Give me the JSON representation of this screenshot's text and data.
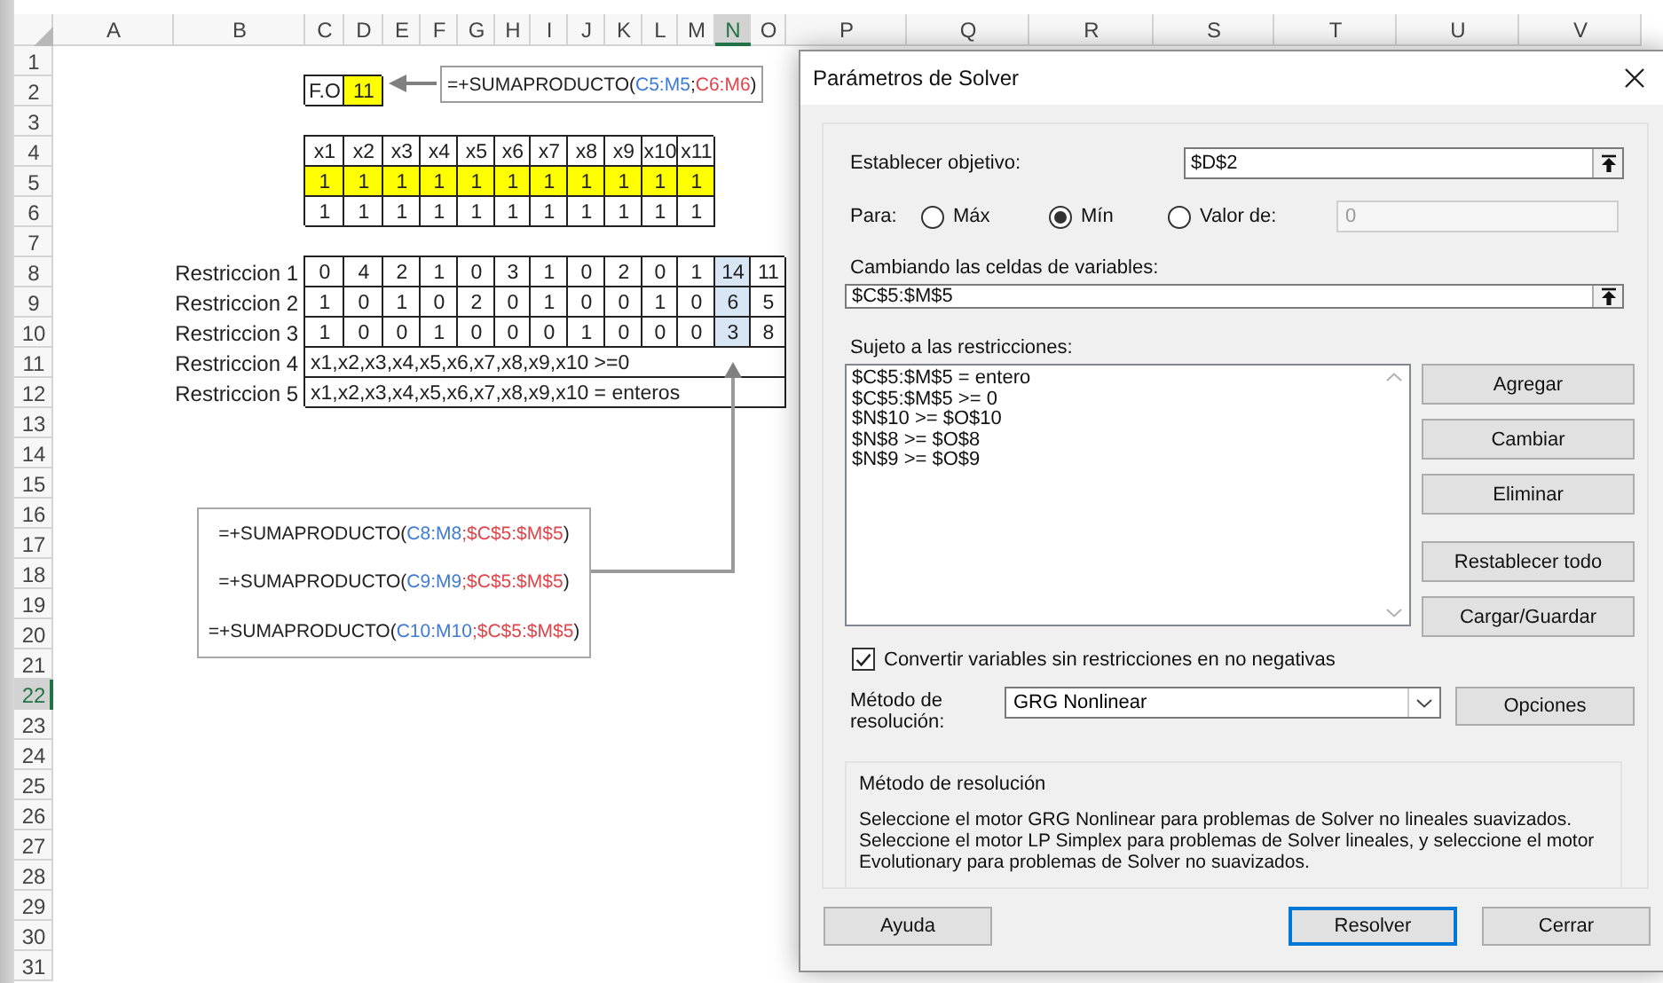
{
  "sheet": {
    "columns": [
      {
        "label": "A",
        "selected": false
      },
      {
        "label": "B",
        "selected": false
      },
      {
        "label": "C",
        "selected": false
      },
      {
        "label": "D",
        "selected": false
      },
      {
        "label": "E",
        "selected": false
      },
      {
        "label": "F",
        "selected": false
      },
      {
        "label": "G",
        "selected": false
      },
      {
        "label": "H",
        "selected": false
      },
      {
        "label": "I",
        "selected": false
      },
      {
        "label": "J",
        "selected": false
      },
      {
        "label": "K",
        "selected": false
      },
      {
        "label": "L",
        "selected": false
      },
      {
        "label": "M",
        "selected": false
      },
      {
        "label": "N",
        "selected": true
      },
      {
        "label": "O",
        "selected": false
      },
      {
        "label": "P",
        "selected": false
      },
      {
        "label": "Q",
        "selected": false
      },
      {
        "label": "R",
        "selected": false
      },
      {
        "label": "S",
        "selected": false
      },
      {
        "label": "T",
        "selected": false
      },
      {
        "label": "U",
        "selected": false
      },
      {
        "label": "V",
        "selected": false
      }
    ],
    "rows": [
      {
        "label": "1",
        "selected": false
      },
      {
        "label": "2",
        "selected": false
      },
      {
        "label": "3",
        "selected": false
      },
      {
        "label": "4",
        "selected": false
      },
      {
        "label": "5",
        "selected": false
      },
      {
        "label": "6",
        "selected": false
      },
      {
        "label": "7",
        "selected": false
      },
      {
        "label": "8",
        "selected": false
      },
      {
        "label": "9",
        "selected": false
      },
      {
        "label": "10",
        "selected": false
      },
      {
        "label": "11",
        "selected": false
      },
      {
        "label": "12",
        "selected": false
      },
      {
        "label": "13",
        "selected": false
      },
      {
        "label": "14",
        "selected": false
      },
      {
        "label": "15",
        "selected": false
      },
      {
        "label": "16",
        "selected": false
      },
      {
        "label": "17",
        "selected": false
      },
      {
        "label": "18",
        "selected": false
      },
      {
        "label": "19",
        "selected": false
      },
      {
        "label": "20",
        "selected": false
      },
      {
        "label": "21",
        "selected": false
      },
      {
        "label": "22",
        "selected": true
      },
      {
        "label": "23",
        "selected": false
      },
      {
        "label": "24",
        "selected": false
      },
      {
        "label": "25",
        "selected": false
      },
      {
        "label": "26",
        "selected": false
      },
      {
        "label": "27",
        "selected": false
      },
      {
        "label": "28",
        "selected": false
      },
      {
        "label": "29",
        "selected": false
      },
      {
        "label": "30",
        "selected": false
      },
      {
        "label": "31",
        "selected": false
      }
    ],
    "objective": {
      "label": "F.O",
      "value": "11",
      "highlighted": true
    },
    "objective_formula": [
      {
        "text": "=+SUMAPRODUCTO(",
        "color": "#222222"
      },
      {
        "text": "C5:M5",
        "color": "#3f7ad6"
      },
      {
        "text": ";",
        "color": "#222222"
      },
      {
        "text": "C6:M6",
        "color": "#e0454b"
      },
      {
        "text": ")",
        "color": "#222222"
      }
    ],
    "variables": {
      "headers": [
        "x1",
        "x2",
        "x3",
        "x4",
        "x5",
        "x6",
        "x7",
        "x8",
        "x9",
        "x10",
        "x11"
      ],
      "rows": [
        {
          "highlighted": true,
          "cells": [
            "1",
            "1",
            "1",
            "1",
            "1",
            "1",
            "1",
            "1",
            "1",
            "1",
            "1"
          ]
        },
        {
          "highlighted": false,
          "cells": [
            "1",
            "1",
            "1",
            "1",
            "1",
            "1",
            "1",
            "1",
            "1",
            "1",
            "1"
          ]
        }
      ]
    },
    "constraints": [
      {
        "label": "Restriccion 1",
        "kind": "values",
        "cells": [
          {
            "value": "0",
            "selected": false
          },
          {
            "value": "4",
            "selected": false
          },
          {
            "value": "2",
            "selected": false
          },
          {
            "value": "1",
            "selected": false
          },
          {
            "value": "0",
            "selected": false
          },
          {
            "value": "3",
            "selected": false
          },
          {
            "value": "1",
            "selected": false
          },
          {
            "value": "0",
            "selected": false
          },
          {
            "value": "2",
            "selected": false
          },
          {
            "value": "0",
            "selected": false
          },
          {
            "value": "1",
            "selected": false
          },
          {
            "value": "14",
            "selected": true
          },
          {
            "value": "11",
            "selected": false
          }
        ]
      },
      {
        "label": "Restriccion 2",
        "kind": "values",
        "cells": [
          {
            "value": "1",
            "selected": false
          },
          {
            "value": "0",
            "selected": false
          },
          {
            "value": "1",
            "selected": false
          },
          {
            "value": "0",
            "selected": false
          },
          {
            "value": "2",
            "selected": false
          },
          {
            "value": "0",
            "selected": false
          },
          {
            "value": "1",
            "selected": false
          },
          {
            "value": "0",
            "selected": false
          },
          {
            "value": "0",
            "selected": false
          },
          {
            "value": "1",
            "selected": false
          },
          {
            "value": "0",
            "selected": false
          },
          {
            "value": "6",
            "selected": true
          },
          {
            "value": "5",
            "selected": false
          }
        ]
      },
      {
        "label": "Restriccion 3",
        "kind": "values",
        "cells": [
          {
            "value": "1",
            "selected": false
          },
          {
            "value": "0",
            "selected": false
          },
          {
            "value": "0",
            "selected": false
          },
          {
            "value": "1",
            "selected": false
          },
          {
            "value": "0",
            "selected": false
          },
          {
            "value": "0",
            "selected": false
          },
          {
            "value": "0",
            "selected": false
          },
          {
            "value": "1",
            "selected": false
          },
          {
            "value": "0",
            "selected": false
          },
          {
            "value": "0",
            "selected": false
          },
          {
            "value": "0",
            "selected": false
          },
          {
            "value": "3",
            "selected": true
          },
          {
            "value": "8",
            "selected": false
          }
        ]
      },
      {
        "label": "Restriccion 4",
        "kind": "text",
        "text": "x1,x2,x3,x4,x5,x6,x7,x8,x9,x10 >=0"
      },
      {
        "label": "Restriccion 5",
        "kind": "text",
        "text": "x1,x2,x3,x4,x5,x6,x7,x8,x9,x10 = enteros"
      }
    ],
    "formula_notes": [
      [
        {
          "text": "=+SUMAPRODUCTO(",
          "color": "#222222"
        },
        {
          "text": "C8:M8",
          "color": "#3f7ad6"
        },
        {
          "text": ";$C$5:$M$5",
          "color": "#e0454b"
        },
        {
          "text": ")",
          "color": "#222222"
        }
      ],
      [
        {
          "text": "=+SUMAPRODUCTO(",
          "color": "#222222"
        },
        {
          "text": "C9:M9",
          "color": "#3f7ad6"
        },
        {
          "text": ";$C$5:$M$5",
          "color": "#e0454b"
        },
        {
          "text": ")",
          "color": "#222222"
        }
      ],
      [
        {
          "text": "=+SUMAPRODUCTO(",
          "color": "#222222"
        },
        {
          "text": "C10:M10",
          "color": "#3f7ad6"
        },
        {
          "text": ";$C$5:$M$5",
          "color": "#e0454b"
        },
        {
          "text": ")",
          "color": "#222222"
        }
      ]
    ]
  },
  "dialog": {
    "title": "Parámetros de Solver",
    "objective": {
      "label": "Establecer objetivo:",
      "value": "$D$2"
    },
    "goal": {
      "label": "Para:",
      "options": [
        {
          "label": "Máx",
          "selected": false
        },
        {
          "label": "Mín",
          "selected": true
        },
        {
          "label": "Valor de:",
          "selected": false
        }
      ],
      "target": {
        "value": "0",
        "disabled": true
      }
    },
    "variables": {
      "label": "Cambiando las celdas de variables:",
      "value": "$C$5:$M$5"
    },
    "constraints": {
      "label": "Sujeto a las restricciones:",
      "items": [
        "$C$5:$M$5 = entero",
        "$C$5:$M$5 >= 0",
        "$N$10 >= $O$10",
        "$N$8 >= $O$8",
        "$N$9 >= $O$9"
      ]
    },
    "edit_buttons": [
      "Agregar",
      "Cambiar",
      "Eliminar"
    ],
    "list_buttons": [
      "Restablecer todo",
      "Cargar/Guardar"
    ],
    "non_negative": {
      "label": "Convertir variables sin restricciones en no negativas",
      "checked": true
    },
    "method": {
      "label": "Método de resolución:",
      "value": "GRG Nonlinear"
    },
    "options_button": "Opciones",
    "method_info": {
      "title": "Método de resolución",
      "text": "Seleccione el motor GRG Nonlinear para problemas de Solver no lineales suavizados. Seleccione el motor LP Simplex para problemas de Solver lineales, y seleccione el motor Evolutionary para problemas de Solver no suavizados."
    },
    "help_button": "Ayuda",
    "buttons": [
      {
        "label": "Resolver",
        "focused": true
      },
      {
        "label": "Cerrar",
        "focused": false
      }
    ]
  }
}
